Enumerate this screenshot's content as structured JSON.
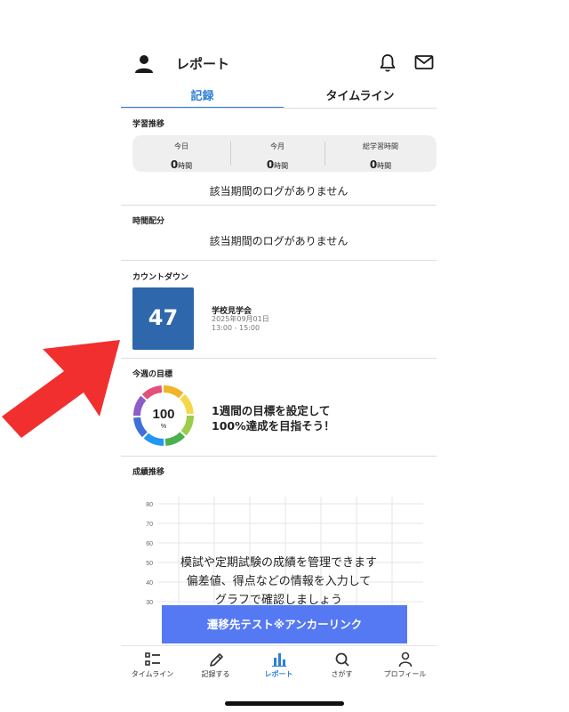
{
  "header": {
    "title": "レポート"
  },
  "tabs": [
    {
      "label": "記録",
      "active": true
    },
    {
      "label": "タイムライン",
      "active": false
    }
  ],
  "study": {
    "label": "学習推移",
    "cells": [
      {
        "label": "今日",
        "value": "0",
        "unit": "時間"
      },
      {
        "label": "今月",
        "value": "0",
        "unit": "時間"
      },
      {
        "label": "総学習時間",
        "value": "0",
        "unit": "時間"
      }
    ],
    "empty_message": "該当期間のログがありません"
  },
  "allocation": {
    "label": "時間配分",
    "empty_message": "該当期間のログがありません"
  },
  "countdown": {
    "label": "カウントダウン",
    "days": "47",
    "event_title": "学校見学会",
    "event_date": "2025年09月01日",
    "event_time": "13:00 - 15:00"
  },
  "weekly_goal": {
    "label": "今週の目標",
    "percent": "100",
    "percent_unit": "%",
    "line1": "1週間の目標を設定して",
    "line2": "100%達成を目指そう！"
  },
  "grades": {
    "label": "成績推移",
    "y_ticks": [
      "80",
      "70",
      "60",
      "50",
      "40",
      "30"
    ],
    "message_line1": "模試や定期試験の成績を管理できます",
    "message_line2": "偏差値、得点などの情報を入力して",
    "message_line3": "グラフで確認しましょう"
  },
  "cta": {
    "label": "遷移先テスト※アンカーリンク"
  },
  "bottom_nav": [
    {
      "label": "タイムライン",
      "icon": "timeline-icon",
      "active": false
    },
    {
      "label": "記録する",
      "icon": "pencil-icon",
      "active": false
    },
    {
      "label": "レポート",
      "icon": "bar-chart-icon",
      "active": true
    },
    {
      "label": "さがす",
      "icon": "search-icon",
      "active": false
    },
    {
      "label": "プロフィール",
      "icon": "profile-icon",
      "active": false
    }
  ],
  "colors": {
    "accent": "#2f7fd6",
    "countdown_bg": "#2e67ab",
    "cta_bg": "#5579f2",
    "arrow": "#f22f2f"
  }
}
